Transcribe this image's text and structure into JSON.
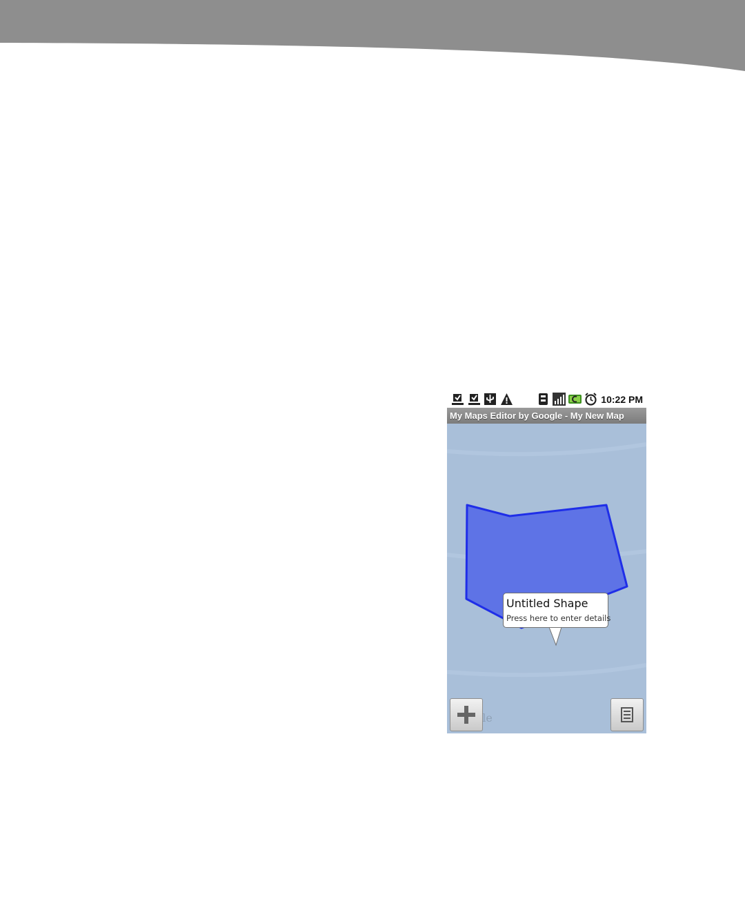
{
  "status_bar": {
    "time": "10:22 PM",
    "icons": [
      "download-icon",
      "download-icon",
      "usb-icon",
      "warning-icon",
      "sd-card-icon",
      "signal-icon",
      "battery-icon",
      "alarm-icon"
    ]
  },
  "app": {
    "title": "My Maps Editor by Google - My New Map"
  },
  "map": {
    "callout": {
      "title": "Untitled Shape",
      "subtitle": "Press here to enter details"
    },
    "attribution": "gle"
  },
  "colors": {
    "shape_fill": "#5e73e6",
    "shape_stroke": "#1f2ee8",
    "map_background": "#a9bfd9"
  }
}
